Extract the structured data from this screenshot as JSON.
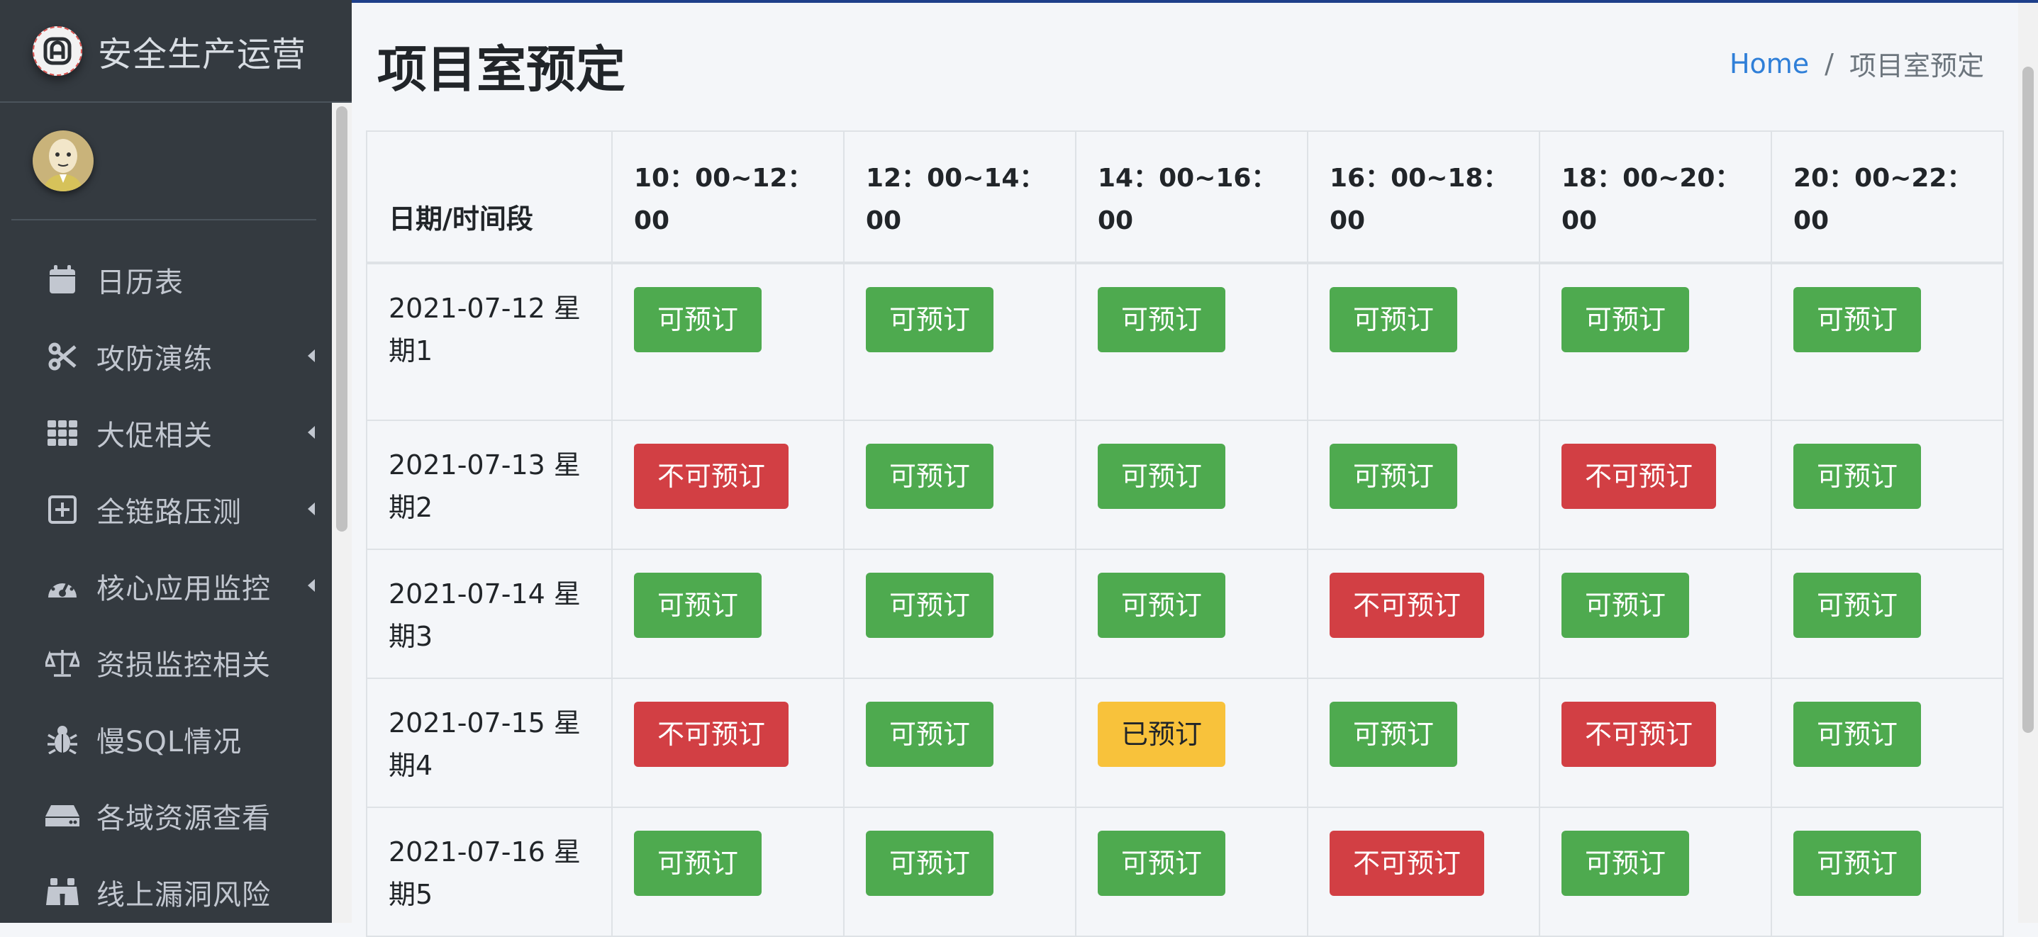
{
  "app": {
    "brand": "安全生产运营"
  },
  "sidebar": {
    "items": [
      {
        "label": "日历表",
        "icon": "calendar-icon",
        "expandable": false
      },
      {
        "label": "攻防演练",
        "icon": "scissors-icon",
        "expandable": true
      },
      {
        "label": "大促相关",
        "icon": "grid-icon",
        "expandable": true
      },
      {
        "label": "全链路压测",
        "icon": "plus-square-icon",
        "expandable": true
      },
      {
        "label": "核心应用监控",
        "icon": "tachometer-icon",
        "expandable": true
      },
      {
        "label": "资损监控相关",
        "icon": "balance-scale-icon",
        "expandable": false
      },
      {
        "label": "慢SQL情况",
        "icon": "bug-icon",
        "expandable": false
      },
      {
        "label": "各域资源查看",
        "icon": "hdd-icon",
        "expandable": false
      },
      {
        "label": "线上漏洞风险",
        "icon": "binoculars-icon",
        "expandable": false
      }
    ]
  },
  "header": {
    "title": "项目室预定",
    "breadcrumb": {
      "home": "Home",
      "separator": "/",
      "current": "项目室预定"
    }
  },
  "table": {
    "corner": "日期/时间段",
    "slots": [
      "10：00~12：00",
      "12：00~14：00",
      "14：00~16：00",
      "16：00~18：00",
      "18：00~20：00",
      "20：00~22：00"
    ],
    "rows": [
      {
        "date": "2021-07-12 星期1",
        "cells": [
          "可预订",
          "可预订",
          "可预订",
          "可预订",
          "可预订",
          "可预订"
        ],
        "status": [
          "ok",
          "ok",
          "ok",
          "ok",
          "ok",
          "ok"
        ]
      },
      {
        "date": "2021-07-13 星期2",
        "cells": [
          "不可预订",
          "可预订",
          "可预订",
          "可预订",
          "不可预订",
          "可预订"
        ],
        "status": [
          "no",
          "ok",
          "ok",
          "ok",
          "no",
          "ok"
        ]
      },
      {
        "date": "2021-07-14 星期3",
        "cells": [
          "可预订",
          "可预订",
          "可预订",
          "不可预订",
          "可预订",
          "可预订"
        ],
        "status": [
          "ok",
          "ok",
          "ok",
          "no",
          "ok",
          "ok"
        ]
      },
      {
        "date": "2021-07-15 星期4",
        "cells": [
          "不可预订",
          "可预订",
          "已预订",
          "可预订",
          "不可预订",
          "可预订"
        ],
        "status": [
          "no",
          "ok",
          "booked",
          "ok",
          "no",
          "ok"
        ]
      },
      {
        "date": "2021-07-16 星期5",
        "cells": [
          "可预订",
          "可预订",
          "可预订",
          "不可预订",
          "可预订",
          "可预订"
        ],
        "status": [
          "ok",
          "ok",
          "ok",
          "no",
          "ok",
          "ok"
        ]
      }
    ]
  },
  "colors": {
    "available": "#4eaa4f",
    "unavailable": "#d23f44",
    "booked": "#f8c23b",
    "link": "#2f7fd8",
    "sidebar": "#343a40"
  }
}
